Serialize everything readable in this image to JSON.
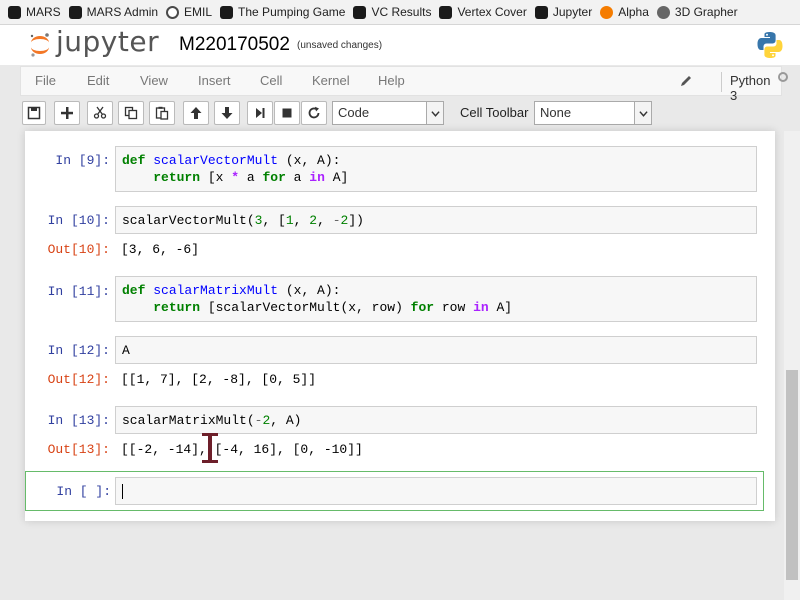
{
  "bookmarks": [
    {
      "label": "MARS",
      "icon": "mars-icon",
      "color": "#1a1a1a"
    },
    {
      "label": "MARS Admin",
      "icon": "mars-icon",
      "color": "#1a1a1a"
    },
    {
      "label": "EMIL",
      "icon": "emil-icon",
      "color": "#4a4a4a"
    },
    {
      "label": "The Pumping Game",
      "icon": "mars-icon",
      "color": "#1a1a1a"
    },
    {
      "label": "VC Results",
      "icon": "mars-icon",
      "color": "#1a1a1a"
    },
    {
      "label": "Vertex Cover",
      "icon": "mars-icon",
      "color": "#1a1a1a"
    },
    {
      "label": "Jupyter",
      "icon": "mars-icon",
      "color": "#1a1a1a"
    },
    {
      "label": "Alpha",
      "icon": "alpha-icon",
      "color": "#f57c00"
    },
    {
      "label": "3D Grapher",
      "icon": "grapher-icon",
      "color": "#666666"
    }
  ],
  "header": {
    "logo_text": "jupyter",
    "notebook_name": "M220170502",
    "status": "(unsaved changes)"
  },
  "menu": {
    "items": [
      "File",
      "Edit",
      "View",
      "Insert",
      "Cell",
      "Kernel",
      "Help"
    ],
    "kernel_name": "Python 3"
  },
  "toolbar": {
    "cell_type": "Code",
    "cell_toolbar_label": "Cell Toolbar",
    "cell_toolbar_value": "None"
  },
  "cells": [
    {
      "in_prompt": "In [9]:",
      "code_lines": [
        "def scalarVectorMult (x, A):",
        "    return [x * a for a in A]"
      ],
      "out_prompt": "",
      "output": ""
    },
    {
      "in_prompt": "In [10]:",
      "code_lines": [
        "scalarVectorMult(3, [1, 2, -2])"
      ],
      "out_prompt": "Out[10]:",
      "output": "[3, 6, -6]"
    },
    {
      "in_prompt": "In [11]:",
      "code_lines": [
        "def scalarMatrixMult (x, A):",
        "    return [scalarVectorMult(x, row) for row in A]"
      ],
      "out_prompt": "",
      "output": ""
    },
    {
      "in_prompt": "In [12]:",
      "code_lines": [
        "A"
      ],
      "out_prompt": "Out[12]:",
      "output": "[[1, 7], [2, -8], [0, 5]]"
    },
    {
      "in_prompt": "In [13]:",
      "code_lines": [
        "scalarMatrixMult(-2, A)"
      ],
      "out_prompt": "Out[13]:",
      "output": "[[-2, -14], [-4, 16], [0, -10]]"
    },
    {
      "in_prompt": "In [ ]:",
      "code_lines": [
        ""
      ],
      "out_prompt": "",
      "output": ""
    }
  ],
  "colors": {
    "in_prompt": "#303f9f",
    "out_prompt": "#d84315",
    "keyword": "#008000",
    "active_cell_border": "#66bb6a"
  }
}
